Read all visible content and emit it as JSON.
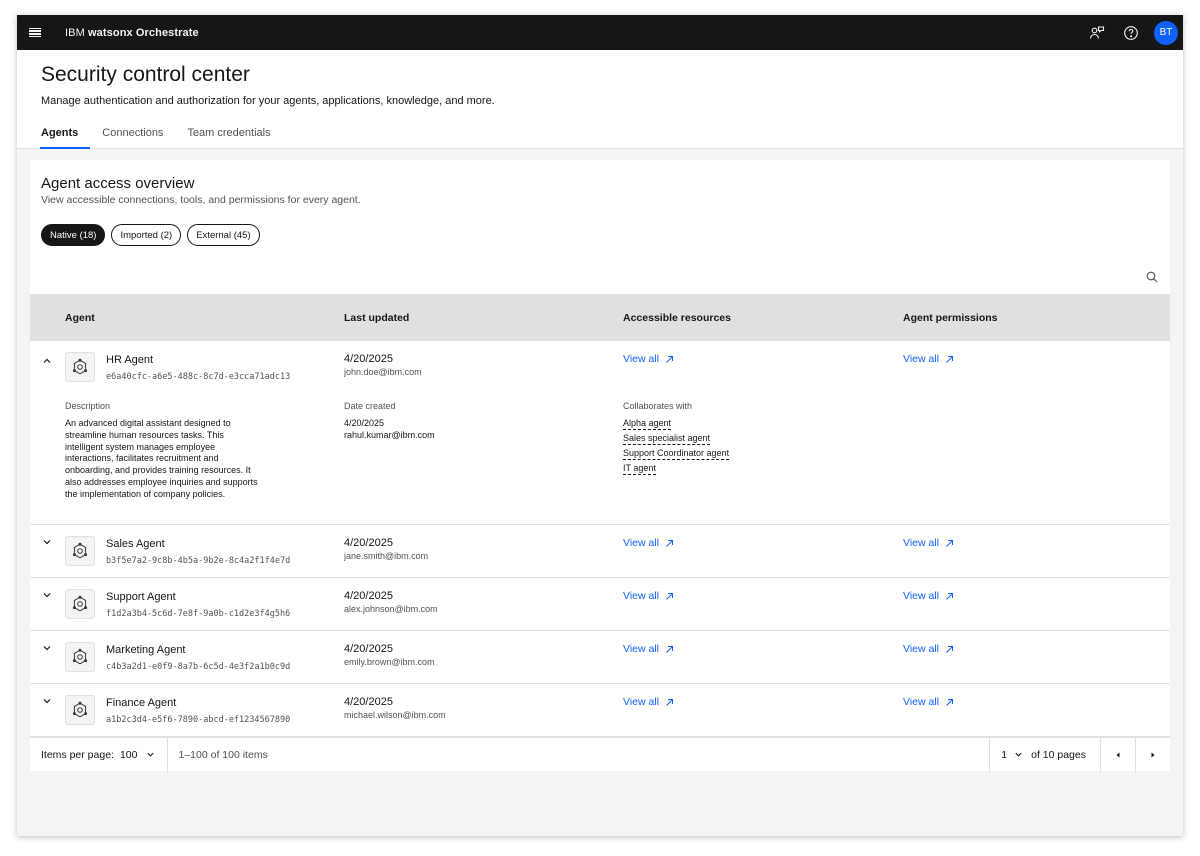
{
  "app": {
    "brand_prefix": "IBM",
    "brand_name": "watsonx Orchestrate",
    "avatar_initials": "BT"
  },
  "page": {
    "title": "Security control center",
    "subtitle": "Manage authentication and authorization for your agents, applications, knowledge, and more."
  },
  "tabs": [
    {
      "label": "Agents",
      "active": true
    },
    {
      "label": "Connections",
      "active": false
    },
    {
      "label": "Team credentials",
      "active": false
    }
  ],
  "overview": {
    "title": "Agent access overview",
    "subtitle": "View accessible connections, tools, and permissions for every agent.",
    "filters": [
      {
        "label": "Native (18)",
        "active": true
      },
      {
        "label": "Imported (2)",
        "active": false
      },
      {
        "label": "External (45)",
        "active": false
      }
    ]
  },
  "table": {
    "headers": {
      "agent": "Agent",
      "updated": "Last updated",
      "resources": "Accessible resources",
      "permissions": "Agent permissions"
    },
    "view_all_label": "View all",
    "rows": [
      {
        "name": "HR Agent",
        "id": "e6a40cfc-a6e5-488c-8c7d-e3cca71adc13",
        "date": "4/20/2025",
        "user": "john.doe@ibm.com",
        "expanded": true
      },
      {
        "name": "Sales Agent",
        "id": "b3f5e7a2-9c8b-4b5a-9b2e-8c4a2f1f4e7d",
        "date": "4/20/2025",
        "user": "jane.smith@ibm.com",
        "expanded": false
      },
      {
        "name": "Support Agent",
        "id": "f1d2a3b4-5c6d-7e8f-9a0b-c1d2e3f4g5h6",
        "date": "4/20/2025",
        "user": "alex.johnson@ibm.com",
        "expanded": false
      },
      {
        "name": "Marketing Agent",
        "id": "c4b3a2d1-e0f9-8a7b-6c5d-4e3f2a1b0c9d",
        "date": "4/20/2025",
        "user": "emily.brown@ibm.com",
        "expanded": false
      },
      {
        "name": "Finance Agent",
        "id": "a1b2c3d4-e5f6-7890-abcd-ef1234567890",
        "date": "4/20/2025",
        "user": "michael.wilson@ibm.com",
        "expanded": false
      }
    ],
    "expanded_detail": {
      "description_label": "Description",
      "description_lines": [
        "An advanced digital assistant designed to",
        "streamline human resources tasks. This",
        "intelligent system manages employee",
        "interactions, facilitates recruitment and",
        "onboarding, and provides training resources. It",
        "also addresses employee inquiries and supports",
        "the implementation of company policies."
      ],
      "created_label": "Date created",
      "created_date": "4/20/2025",
      "created_user": "rahul.kumar@ibm.com",
      "collab_label": "Collaborates with",
      "collaborators": [
        "Alpha agent",
        "Sales specialist agent",
        "Support Coordinator agent",
        "IT agent"
      ]
    }
  },
  "pagination": {
    "items_per_page_label": "Items per page:",
    "items_per_page": "100",
    "range": "1–100 of 100 items",
    "page": "1",
    "of_pages": "of 10 pages"
  },
  "colors": {
    "accent": "#0f62fe",
    "topbar": "#161616",
    "header_row": "#e0e0e0"
  }
}
